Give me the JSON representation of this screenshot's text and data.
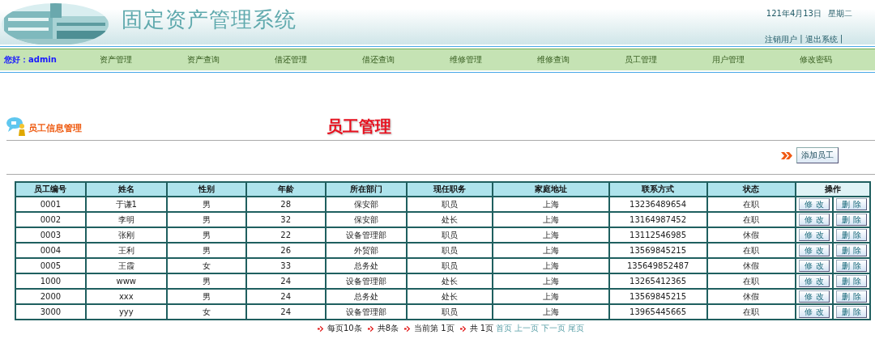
{
  "header": {
    "title": "固定资产管理系统",
    "date": "121年4月13日",
    "weekday": "星期二",
    "links": [
      "注销用户",
      "退出系统"
    ],
    "separator": "|"
  },
  "nav": {
    "greeting": "您好：admin",
    "items": [
      "资产管理",
      "资产查询",
      "借还管理",
      "借还查询",
      "维修管理",
      "维修查询",
      "员工管理",
      "用户管理",
      "修改密码"
    ]
  },
  "section": {
    "label": "员工信息管理",
    "title": "员工管理",
    "add_button": "添加员工"
  },
  "table": {
    "columns": [
      "员工编号",
      "姓名",
      "性别",
      "年龄",
      "所在部门",
      "现任职务",
      "家庭地址",
      "联系方式",
      "状态",
      "操作"
    ],
    "rows": [
      {
        "cells": [
          "0001",
          "于谦1",
          "男",
          "28",
          "保安部",
          "职员",
          "上海",
          "13236489654",
          "在职"
        ],
        "actions": [
          "修 改",
          "删 除"
        ]
      },
      {
        "cells": [
          "0002",
          "李明",
          "男",
          "32",
          "保安部",
          "处长",
          "上海",
          "13164987452",
          "在职"
        ],
        "actions": [
          "修 改",
          "删 除"
        ]
      },
      {
        "cells": [
          "0003",
          "张刚",
          "男",
          "22",
          "设备管理部",
          "职员",
          "上海",
          "13112546985",
          "休假"
        ],
        "actions": [
          "修 改",
          "删 除"
        ]
      },
      {
        "cells": [
          "0004",
          "王利",
          "男",
          "26",
          "外贸部",
          "职员",
          "上海",
          "13569845215",
          "在职"
        ],
        "actions": [
          "修 改",
          "删 除"
        ]
      },
      {
        "cells": [
          "0005",
          "王霞",
          "女",
          "33",
          "总务处",
          "职员",
          "上海",
          "135649852487",
          "休假"
        ],
        "actions": [
          "修 改",
          "删 除"
        ]
      },
      {
        "cells": [
          "1000",
          "www",
          "男",
          "24",
          "设备管理部",
          "处长",
          "上海",
          "13265412365",
          "在职"
        ],
        "actions": [
          "修 改",
          "删 除"
        ]
      },
      {
        "cells": [
          "2000",
          "xxx",
          "男",
          "24",
          "总务处",
          "处长",
          "上海",
          "13569845215",
          "休假"
        ],
        "actions": [
          "修 改",
          "删 除"
        ]
      },
      {
        "cells": [
          "3000",
          "yyy",
          "女",
          "24",
          "设备管理部",
          "职员",
          "上海",
          "13965445665",
          "在职"
        ],
        "actions": [
          "修 改",
          "删 除"
        ]
      }
    ]
  },
  "pagination": {
    "info": [
      "每页10条",
      "共8条",
      "当前第 1页",
      "共 1页"
    ],
    "links": [
      "首页",
      "上一页",
      "下一页",
      "尾页"
    ]
  }
}
